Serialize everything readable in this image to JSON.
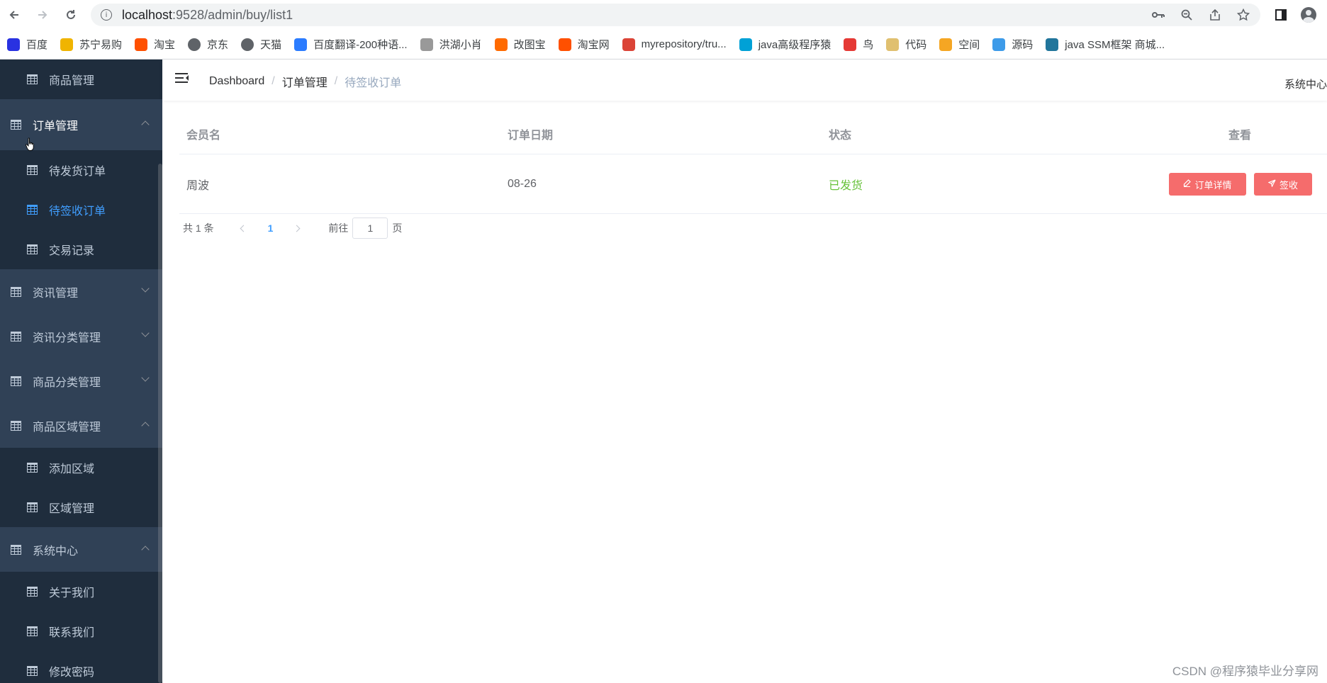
{
  "browser": {
    "url_host": "localhost",
    "url_path": ":9528/admin/buy/list1",
    "bookmarks": [
      {
        "label": "百度",
        "icon": "baidu-paw-icon",
        "color": "#2932e1"
      },
      {
        "label": "苏宁易购",
        "icon": "suning-icon",
        "color": "#f0b400"
      },
      {
        "label": "淘宝",
        "icon": "taobao-icon",
        "color": "#ff5000"
      },
      {
        "label": "京东",
        "icon": "globe-icon",
        "color": "#5f6368"
      },
      {
        "label": "天猫",
        "icon": "globe-icon",
        "color": "#5f6368"
      },
      {
        "label": "百度翻译-200种语...",
        "icon": "translate-icon",
        "color": "#2b7cff"
      },
      {
        "label": "洪湖小肖",
        "icon": "bird-icon",
        "color": "#999999"
      },
      {
        "label": "改图宝",
        "icon": "gaitubao-icon",
        "color": "#ff6a00"
      },
      {
        "label": "淘宝网",
        "icon": "taobao-icon",
        "color": "#ff5000"
      },
      {
        "label": "myrepository/tru...",
        "icon": "chrome-icon",
        "color": "#db4437"
      },
      {
        "label": "java高级程序猿",
        "icon": "bilibili-icon",
        "color": "#00a1d6"
      },
      {
        "label": "鸟",
        "icon": "bird-red-icon",
        "color": "#e53935"
      },
      {
        "label": "代码",
        "icon": "code-icon",
        "color": "#e0c070"
      },
      {
        "label": "空间",
        "icon": "qzone-icon",
        "color": "#f5a623"
      },
      {
        "label": "源码",
        "icon": "fish-icon",
        "color": "#3d9be9"
      },
      {
        "label": "java SSM框架 商城...",
        "icon": "wordpress-icon",
        "color": "#21759b"
      }
    ]
  },
  "sidebar": {
    "items": [
      {
        "label": "商品管理",
        "level": "sub"
      },
      {
        "label": "订单管理",
        "level": "top",
        "expanded": true
      },
      {
        "label": "待发货订单",
        "level": "sub"
      },
      {
        "label": "待签收订单",
        "level": "sub",
        "active": true
      },
      {
        "label": "交易记录",
        "level": "sub"
      },
      {
        "label": "资讯管理",
        "level": "top",
        "expanded": false
      },
      {
        "label": "资讯分类管理",
        "level": "top",
        "expanded": false
      },
      {
        "label": "商品分类管理",
        "level": "top",
        "expanded": false
      },
      {
        "label": "商品区域管理",
        "level": "top",
        "expanded": true
      },
      {
        "label": "添加区域",
        "level": "sub"
      },
      {
        "label": "区域管理",
        "level": "sub"
      },
      {
        "label": "系统中心",
        "level": "top",
        "expanded": true
      },
      {
        "label": "关于我们",
        "level": "sub"
      },
      {
        "label": "联系我们",
        "level": "sub"
      },
      {
        "label": "修改密码",
        "level": "sub"
      }
    ],
    "active_color": "#409eff",
    "bg_color": "#304156",
    "sub_bg_color": "#1f2d3d"
  },
  "navbar": {
    "breadcrumb": [
      "Dashboard",
      "订单管理",
      "待签收订单"
    ],
    "right_link": "系统中心"
  },
  "table": {
    "headers": [
      "会员名",
      "订单日期",
      "状态",
      "查看"
    ],
    "rows": [
      {
        "member": "周波",
        "date": "08-26",
        "status": "已发货",
        "actions": [
          "订单详情",
          "签收"
        ]
      }
    ]
  },
  "pagination": {
    "total_text": "共 1 条",
    "current_page": "1",
    "goto_prefix": "前往",
    "goto_value": "1",
    "goto_suffix": "页"
  },
  "watermark": "CSDN @程序猿毕业分享网",
  "colors": {
    "danger": "#f56c6c",
    "success": "#67c23a",
    "primary": "#409eff"
  }
}
